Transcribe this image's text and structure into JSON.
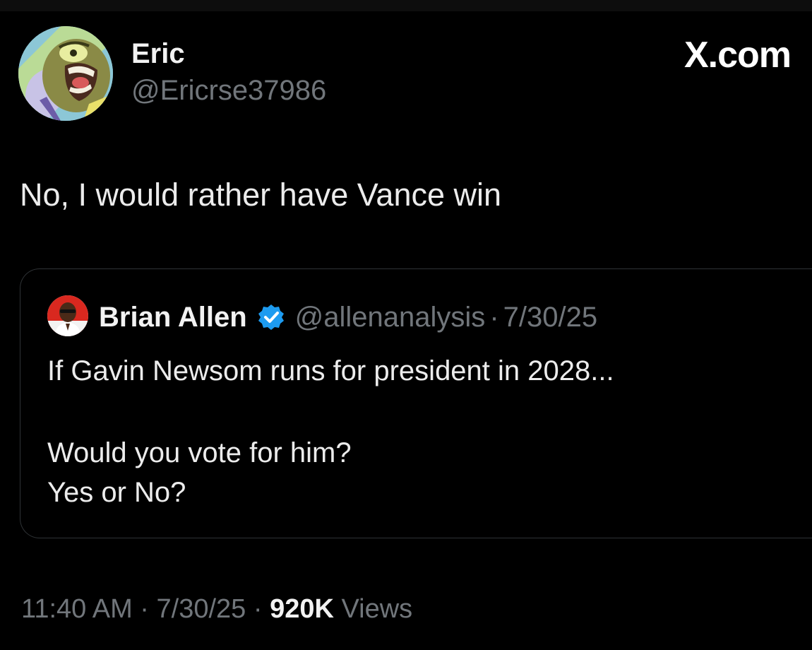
{
  "brand": "X.com",
  "tweet": {
    "author_name": "Eric",
    "author_handle": "@Ericrse37986",
    "text": "No, I would rather have Vance win",
    "time": "11:40 AM",
    "date": "7/30/25",
    "separator": "·",
    "views_count": "920K",
    "views_label": "Views"
  },
  "quoted": {
    "author_name": "Brian Allen",
    "author_handle": "@allenanalysis",
    "separator": "·",
    "date": "7/30/25",
    "lines": [
      "If Gavin Newsom runs for president in 2028...",
      "Would you vote for him?",
      "Yes or No?"
    ]
  },
  "icons": {
    "avatar": "cartoon-fish-avatar-icon",
    "quote_avatar": "person-avatar-icon",
    "verified": "verified-badge-icon"
  },
  "colors": {
    "background": "#000000",
    "text": "#e7e9ea",
    "muted": "#71767b",
    "verified": "#1d9bf0",
    "border": "#2f3336"
  }
}
